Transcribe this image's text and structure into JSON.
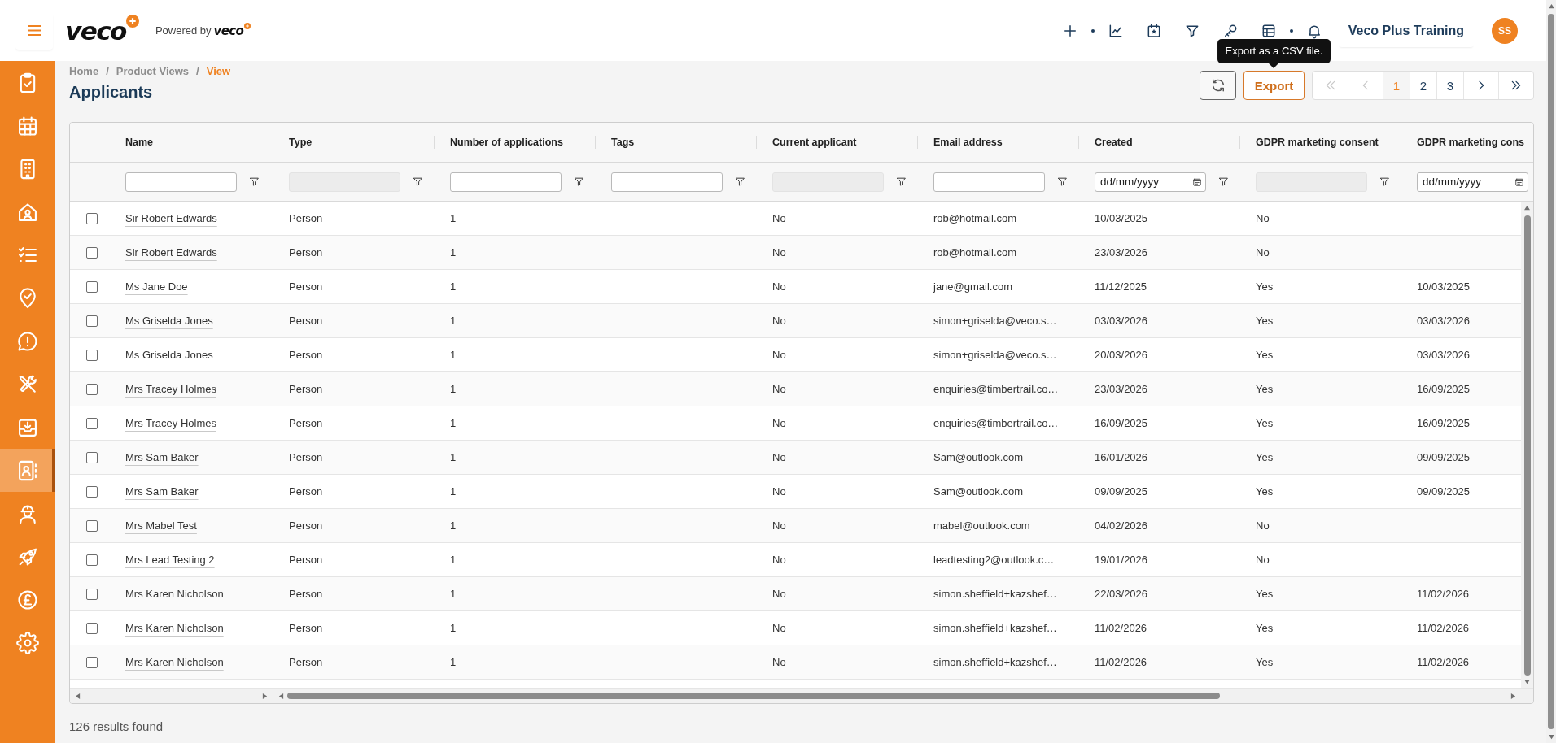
{
  "header": {
    "logo": "veco",
    "powered_by": "Powered by",
    "powered_by_logo": "veco",
    "account_name": "Veco Plus Training",
    "avatar_initials": "SS"
  },
  "sidebar": {
    "items": [
      {
        "selected": false
      },
      {
        "selected": false
      },
      {
        "selected": false
      },
      {
        "selected": false
      },
      {
        "selected": false
      },
      {
        "selected": false
      },
      {
        "selected": false
      },
      {
        "selected": false
      },
      {
        "selected": false
      },
      {
        "selected": true
      },
      {
        "selected": false
      },
      {
        "selected": false
      },
      {
        "selected": false
      },
      {
        "selected": false
      }
    ]
  },
  "breadcrumb": [
    {
      "kind": "link",
      "label": "Home"
    },
    {
      "kind": "separator",
      "label": "/"
    },
    {
      "kind": "link",
      "label": "Product Views"
    },
    {
      "kind": "separator",
      "label": "/"
    },
    {
      "kind": "current",
      "label": "View"
    }
  ],
  "page_title": "Applicants",
  "toolbar": {
    "export_button": "Export",
    "tooltip": "Export as a CSV file."
  },
  "pagination": {
    "first": {
      "disabled": true
    },
    "previous": {
      "disabled": true
    },
    "pages": [
      {
        "label": "1",
        "selected": true
      },
      {
        "label": "2",
        "selected": false
      },
      {
        "label": "3",
        "selected": false
      }
    ],
    "next": {
      "disabled": false
    },
    "last": {
      "disabled": false
    }
  },
  "table": {
    "columns": [
      {
        "label": "Name",
        "filter": {
          "kind": "text",
          "disabled": false
        }
      },
      {
        "label": "Type",
        "filter": {
          "kind": "text",
          "disabled": true
        }
      },
      {
        "label": "Number of applications",
        "filter": {
          "kind": "text",
          "disabled": false
        }
      },
      {
        "label": "Tags",
        "filter": {
          "kind": "text",
          "disabled": false
        }
      },
      {
        "label": "Current applicant",
        "filter": {
          "kind": "text",
          "disabled": true
        }
      },
      {
        "label": "Email address",
        "filter": {
          "kind": "text",
          "disabled": false
        }
      },
      {
        "label": "Created",
        "filter": {
          "kind": "date",
          "placeholder": "dd/mm/yyyy",
          "disabled": false
        }
      },
      {
        "label": "GDPR marketing consent",
        "filter": {
          "kind": "text",
          "disabled": true
        }
      },
      {
        "label": "GDPR marketing cons",
        "filter": {
          "kind": "date",
          "placeholder": "dd/mm/yyyy",
          "disabled": false
        }
      }
    ],
    "rows": [
      {
        "checked": false,
        "name": "Sir Robert Edwards",
        "type": "Person",
        "number_of_applications": "1",
        "current_applicant": "No",
        "email_address": "rob@hotmail.com",
        "created": "10/03/2025",
        "gdpr_marketing_consent": "No"
      },
      {
        "checked": false,
        "name": "Sir Robert Edwards",
        "type": "Person",
        "number_of_applications": "1",
        "current_applicant": "No",
        "email_address": "rob@hotmail.com",
        "created": "23/03/2026",
        "gdpr_marketing_consent": "No"
      },
      {
        "checked": false,
        "name": "Ms Jane Doe",
        "type": "Person",
        "number_of_applications": "1",
        "current_applicant": "No",
        "email_address": "jane@gmail.com",
        "created": "11/12/2025",
        "gdpr_marketing_consent": "Yes",
        "column_9": "10/03/2025"
      },
      {
        "checked": false,
        "name": "Ms Griselda Jones",
        "type": "Person",
        "number_of_applications": "1",
        "current_applicant": "No",
        "email_address": "simon+griselda@veco.s…",
        "created": "03/03/2026",
        "gdpr_marketing_consent": "Yes",
        "column_9": "03/03/2026"
      },
      {
        "checked": false,
        "name": "Ms Griselda Jones",
        "type": "Person",
        "number_of_applications": "1",
        "current_applicant": "No",
        "email_address": "simon+griselda@veco.s…",
        "created": "20/03/2026",
        "gdpr_marketing_consent": "Yes",
        "column_9": "03/03/2026"
      },
      {
        "checked": false,
        "name": "Mrs Tracey Holmes",
        "type": "Person",
        "number_of_applications": "1",
        "current_applicant": "No",
        "email_address": "enquiries@timbertrail.co…",
        "created": "23/03/2026",
        "gdpr_marketing_consent": "Yes",
        "column_9": "16/09/2025"
      },
      {
        "checked": false,
        "name": "Mrs Tracey Holmes",
        "type": "Person",
        "number_of_applications": "1",
        "current_applicant": "No",
        "email_address": "enquiries@timbertrail.co…",
        "created": "16/09/2025",
        "gdpr_marketing_consent": "Yes",
        "column_9": "16/09/2025"
      },
      {
        "checked": false,
        "name": "Mrs Sam Baker",
        "type": "Person",
        "number_of_applications": "1",
        "current_applicant": "No",
        "email_address": "Sam@outlook.com",
        "created": "16/01/2026",
        "gdpr_marketing_consent": "Yes",
        "column_9": "09/09/2025"
      },
      {
        "checked": false,
        "name": "Mrs Sam Baker",
        "type": "Person",
        "number_of_applications": "1",
        "current_applicant": "No",
        "email_address": "Sam@outlook.com",
        "created": "09/09/2025",
        "gdpr_marketing_consent": "Yes",
        "column_9": "09/09/2025"
      },
      {
        "checked": false,
        "name": "Mrs Mabel Test",
        "type": "Person",
        "number_of_applications": "1",
        "current_applicant": "No",
        "email_address": "mabel@outlook.com",
        "created": "04/02/2026",
        "gdpr_marketing_consent": "No"
      },
      {
        "checked": false,
        "name": "Mrs Lead Testing 2",
        "type": "Person",
        "number_of_applications": "1",
        "current_applicant": "No",
        "email_address": "leadtesting2@outlook.c…",
        "created": "19/01/2026",
        "gdpr_marketing_consent": "No"
      },
      {
        "checked": false,
        "name": "Mrs Karen Nicholson",
        "type": "Person",
        "number_of_applications": "1",
        "current_applicant": "No",
        "email_address": "simon.sheffield+kazshef…",
        "created": "22/03/2026",
        "gdpr_marketing_consent": "Yes",
        "column_9": "11/02/2026"
      },
      {
        "checked": false,
        "name": "Mrs Karen Nicholson",
        "type": "Person",
        "number_of_applications": "1",
        "current_applicant": "No",
        "email_address": "simon.sheffield+kazshef…",
        "created": "11/02/2026",
        "gdpr_marketing_consent": "Yes",
        "column_9": "11/02/2026"
      },
      {
        "checked": false,
        "name": "Mrs Karen Nicholson",
        "type": "Person",
        "number_of_applications": "1",
        "current_applicant": "No",
        "email_address": "simon.sheffield+kazshef…",
        "created": "11/02/2026",
        "gdpr_marketing_consent": "Yes",
        "column_9": "11/02/2026"
      }
    ]
  },
  "status_bar": {
    "results": "126 results found"
  }
}
